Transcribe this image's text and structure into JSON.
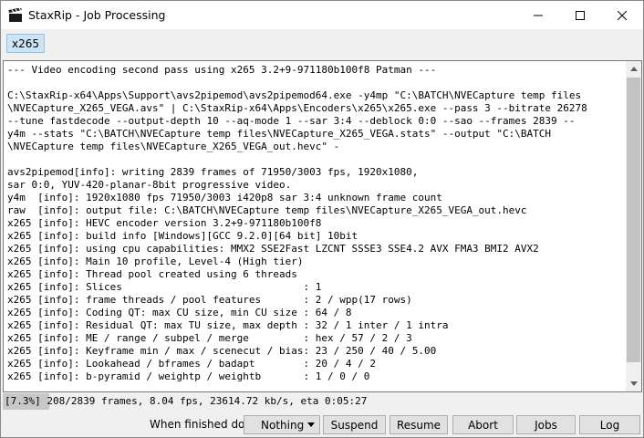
{
  "window": {
    "title": "StaxRip - Job Processing"
  },
  "tabs": [
    {
      "label": "x265"
    }
  ],
  "log": {
    "lines": [
      "--- Video encoding second pass using x265 3.2+9-971180b100f8 Patman ---",
      "",
      "C:\\StaxRip-x64\\Apps\\Support\\avs2pipemod\\avs2pipemod64.exe -y4mp \"C:\\BATCH\\NVECapture temp files",
      "\\NVECapture_X265_VEGA.avs\" | C:\\StaxRip-x64\\Apps\\Encoders\\x265\\x265.exe --pass 3 --bitrate 26278",
      "--tune fastdecode --output-depth 10 --aq-mode 1 --sar 3:4 --deblock 0:0 --sao --frames 2839 --",
      "y4m --stats \"C:\\BATCH\\NVECapture temp files\\NVECapture_X265_VEGA.stats\" --output \"C:\\BATCH",
      "\\NVECapture temp files\\NVECapture_X265_VEGA_out.hevc\" -",
      "",
      "avs2pipemod[info]: writing 2839 frames of 71950/3003 fps, 1920x1080,",
      "sar 0:0, YUV-420-planar-8bit progressive video.",
      "y4m  [info]: 1920x1080 fps 71950/3003 i420p8 sar 3:4 unknown frame count",
      "raw  [info]: output file: C:\\BATCH\\NVECapture temp files\\NVECapture_X265_VEGA_out.hevc",
      "x265 [info]: HEVC encoder version 3.2+9-971180b100f8",
      "x265 [info]: build info [Windows][GCC 9.2.0][64 bit] 10bit",
      "x265 [info]: using cpu capabilities: MMX2 SSE2Fast LZCNT SSSE3 SSE4.2 AVX FMA3 BMI2 AVX2",
      "x265 [info]: Main 10 profile, Level-4 (High tier)",
      "x265 [info]: Thread pool created using 6 threads",
      "x265 [info]: Slices                              : 1",
      "x265 [info]: frame threads / pool features       : 2 / wpp(17 rows)",
      "x265 [info]: Coding QT: max CU size, min CU size : 64 / 8",
      "x265 [info]: Residual QT: max TU size, max depth : 32 / 1 inter / 1 intra",
      "x265 [info]: ME / range / subpel / merge         : hex / 57 / 2 / 3",
      "x265 [info]: Keyframe min / max / scenecut / bias: 23 / 250 / 40 / 5.00",
      "x265 [info]: Lookahead / bframes / badapt        : 20 / 4 / 2",
      "x265 [info]: b-pyramid / weightp / weightb       : 1 / 0 / 0"
    ]
  },
  "status": {
    "percent": "[7.3%]",
    "progress_fraction": 0.073,
    "text": " 208/2839 frames, 8.04 fps, 23614.72 kb/s, eta 0:05:27"
  },
  "controls": {
    "finished_label": "When finished do:",
    "finished_value": "Nothing",
    "suspend": "Suspend",
    "resume": "Resume",
    "abort": "Abort",
    "jobs": "Jobs",
    "log": "Log"
  },
  "colors": {
    "tab_active_bg": "#cce4f7",
    "progress_fill": "#c8c8c8"
  },
  "icons": {
    "app": "clapperboard-icon",
    "minimize": "minimize-icon",
    "maximize": "maximize-icon",
    "close": "close-icon"
  }
}
